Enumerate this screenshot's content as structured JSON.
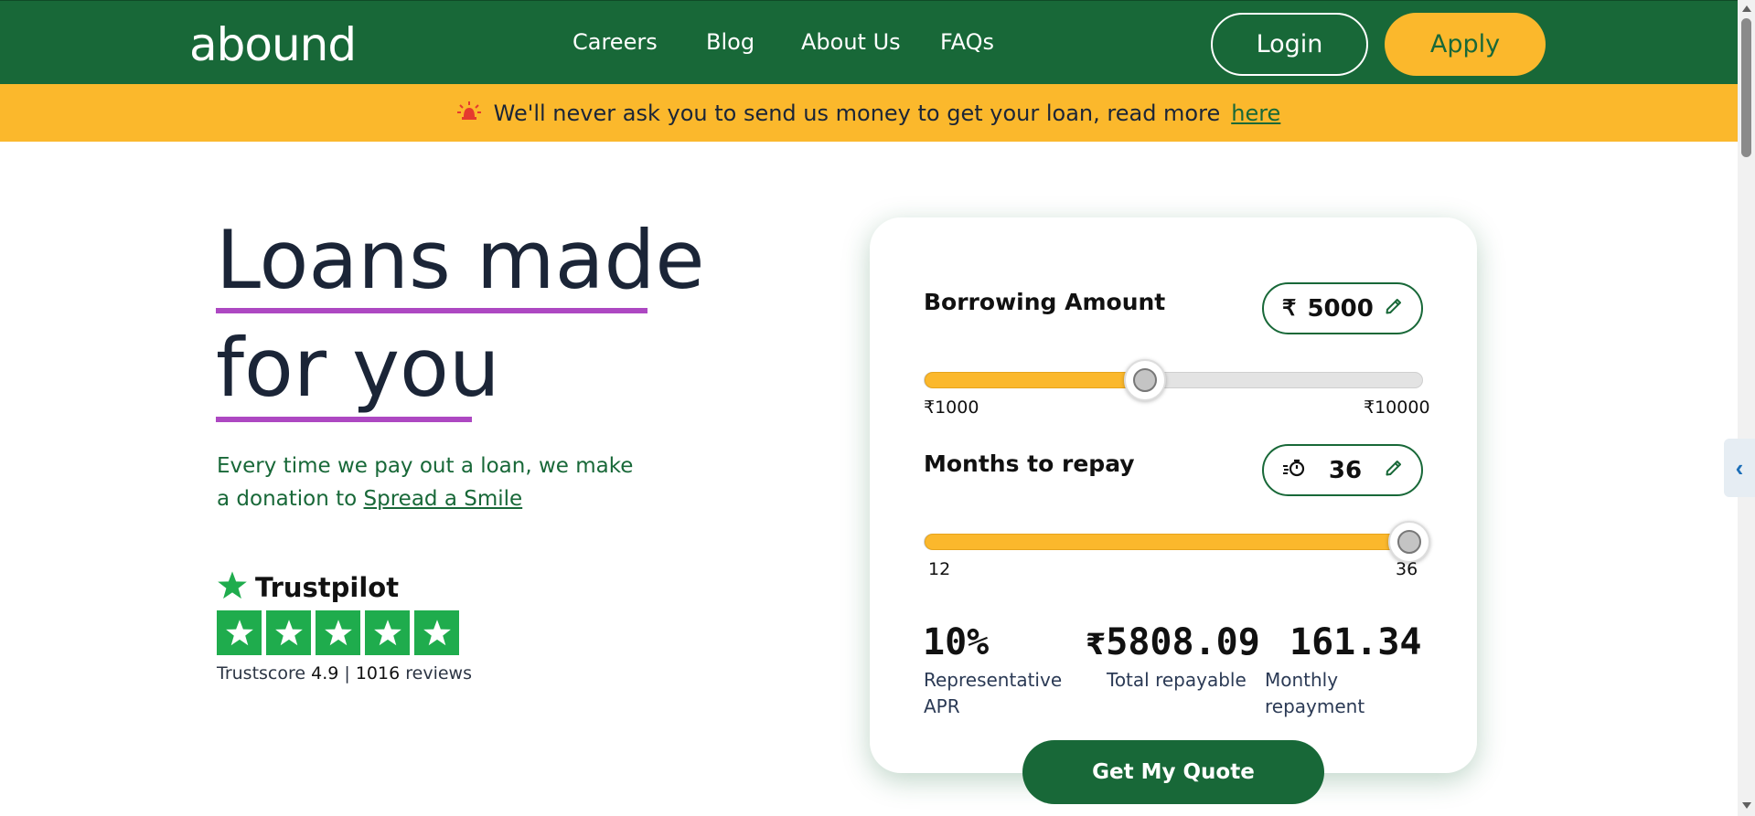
{
  "header": {
    "logo": "abound",
    "nav": [
      "Careers",
      "Blog",
      "About Us",
      "FAQs"
    ],
    "login_label": "Login",
    "apply_label": "Apply"
  },
  "banner": {
    "text": "We'll never ask you to send us money to get your loan, read more",
    "link": "here"
  },
  "hero": {
    "title_line1": "Loans made",
    "title_line2": "for you",
    "donation_text": "Every time we pay out a loan, we make a donation to",
    "donation_link": "Spread a Smile"
  },
  "trustpilot": {
    "name": "Trustpilot",
    "stars": 5,
    "score_prefix": "Trustscore",
    "score": "4.9",
    "separator": "|",
    "reviews_count": "1016",
    "reviews_label": "reviews"
  },
  "calculator": {
    "borrow": {
      "label": "Borrowing Amount",
      "currency_symbol": "₹",
      "value": "5000",
      "min_label": "₹1000",
      "max_label": "₹10000",
      "level": 0.444
    },
    "months": {
      "label": "Months to repay",
      "value": "36",
      "min_label": "12",
      "max_label": "36",
      "level": 1.0
    },
    "stats": {
      "apr_value": "10%",
      "apr_label": "Representative APR",
      "total_symbol": "₹",
      "total_value": "5808.09",
      "total_label": "Total repayable",
      "monthly_value": "161.34",
      "monthly_label": "Monthly repayment"
    },
    "quote_label": "Get My Quote"
  },
  "colors": {
    "brand_green": "#186838",
    "accent_yellow": "#fbb82c",
    "underline_purple": "#ad48c2",
    "trustpilot_green": "#1fac4d"
  },
  "icons": [
    "siren-icon",
    "pencil-icon",
    "stopwatch-icon",
    "star-icon",
    "chevron-left-icon"
  ]
}
